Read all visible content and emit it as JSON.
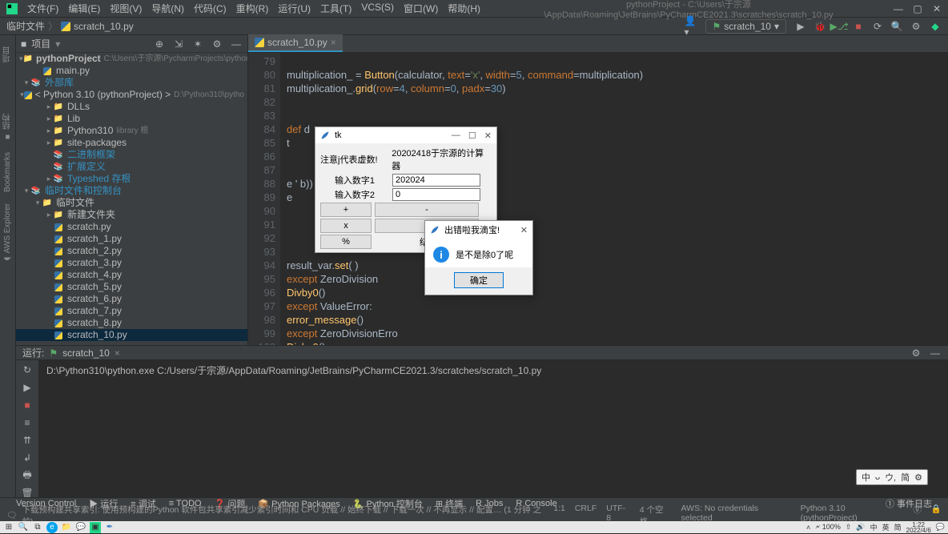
{
  "window": {
    "title_path": "pythonProject - C:\\Users\\于宗源\\AppData\\Roaming\\JetBrains\\PyCharmCE2021.3\\scratches\\scratch_10.py"
  },
  "menus": [
    "文件(F)",
    "编辑(E)",
    "视图(V)",
    "导航(N)",
    "代码(C)",
    "重构(R)",
    "运行(U)",
    "工具(T)",
    "VCS(S)",
    "窗口(W)",
    "帮助(H)"
  ],
  "breadcrumb": {
    "a": "临时文件",
    "b": "scratch_10.py"
  },
  "run_config": {
    "name": "scratch_10"
  },
  "project_panel": {
    "title": "项目"
  },
  "tree": [
    {
      "depth": 0,
      "arrow": "▾",
      "icon": "folder",
      "name": "pythonProject",
      "hint": "C:\\Users\\于宗源\\PycharmProjects\\python",
      "bold": true
    },
    {
      "depth": 1,
      "arrow": "",
      "icon": "py",
      "name": "main.py"
    },
    {
      "depth": 0,
      "arrow": "▾",
      "icon": "lib",
      "name": "外部库",
      "class": "lib"
    },
    {
      "depth": 1,
      "arrow": "▾",
      "icon": "py",
      "name": "< Python 3.10 (pythonProject) >",
      "hint": "D:\\Python310\\pytho"
    },
    {
      "depth": 2,
      "arrow": "▸",
      "icon": "folder",
      "name": "DLLs"
    },
    {
      "depth": 2,
      "arrow": "▸",
      "icon": "folder",
      "name": "Lib"
    },
    {
      "depth": 2,
      "arrow": "▸",
      "icon": "folder",
      "name": "Python310",
      "hint": "library 根"
    },
    {
      "depth": 2,
      "arrow": "▸",
      "icon": "folder",
      "name": "site-packages"
    },
    {
      "depth": 2,
      "arrow": "",
      "icon": "lib",
      "name": "二进制框架",
      "class": "lib"
    },
    {
      "depth": 2,
      "arrow": "",
      "icon": "lib",
      "name": "扩展定义",
      "class": "lib"
    },
    {
      "depth": 2,
      "arrow": "▸",
      "icon": "lib",
      "name": "Typeshed 存根",
      "class": "lib"
    },
    {
      "depth": 0,
      "arrow": "▾",
      "icon": "lib",
      "name": "临时文件和控制台",
      "class": "lib"
    },
    {
      "depth": 1,
      "arrow": "▾",
      "icon": "folder",
      "name": "临时文件"
    },
    {
      "depth": 2,
      "arrow": "▸",
      "icon": "folder",
      "name": "新建文件夹"
    },
    {
      "depth": 2,
      "arrow": "",
      "icon": "py",
      "name": "scratch.py"
    },
    {
      "depth": 2,
      "arrow": "",
      "icon": "py",
      "name": "scratch_1.py"
    },
    {
      "depth": 2,
      "arrow": "",
      "icon": "py",
      "name": "scratch_2.py"
    },
    {
      "depth": 2,
      "arrow": "",
      "icon": "py",
      "name": "scratch_3.py"
    },
    {
      "depth": 2,
      "arrow": "",
      "icon": "py",
      "name": "scratch_4.py"
    },
    {
      "depth": 2,
      "arrow": "",
      "icon": "py",
      "name": "scratch_5.py"
    },
    {
      "depth": 2,
      "arrow": "",
      "icon": "py",
      "name": "scratch_6.py"
    },
    {
      "depth": 2,
      "arrow": "",
      "icon": "py",
      "name": "scratch_7.py"
    },
    {
      "depth": 2,
      "arrow": "",
      "icon": "py",
      "name": "scratch_8.py"
    },
    {
      "depth": 2,
      "arrow": "",
      "icon": "py",
      "name": "scratch_10.py",
      "sel": true
    }
  ],
  "editor": {
    "tab": "scratch_10.py",
    "line_start": 79,
    "lines": [
      "",
      "multiplication_ = Button(calculator, text='x', width=5, command=multiplication)",
      "multiplication_.grid(row=4, column=0, padx=30)",
      "",
      "",
      "def d",
      "    t",
      "",
      "",
      "        ",
      "        e                                                                 ' b))",
      "        e",
      "",
      "",
      "",
      "",
      "            result_var.set(                           )",
      "        except ZeroDivision",
      "            Divby0()",
      "        except ValueError:",
      "            error_message()",
      "    except ZeroDivisionErro",
      "        Divby0()"
    ]
  },
  "run": {
    "label": "运行:",
    "config": "scratch_10",
    "output": "D:\\Python310\\python.exe C:/Users/于宗源/AppData/Roaming/JetBrains/PyCharmCE2021.3/scratches/scratch_10.py"
  },
  "bottom_tabs": [
    "Version Control",
    "▶ 运行",
    "≡ 调试",
    "≡ TODO",
    "❓ 问题",
    "📦 Python Packages",
    "🐍 Python 控制台",
    "⊞ 终端",
    "R Jobs",
    "R Console"
  ],
  "bottom_right": "① 事件日志",
  "status": {
    "msg": "下载预构建共享索引: 使用预构建的Python 软件包共享索引减少索引时间和 CPU 负载 // 始终下载 // 下载一次 // 不再显示 // 配置… (1 分钟 之前)",
    "pos": "1:1",
    "crlf": "CRLF",
    "enc": "UTF-8",
    "indent": "4 个空格",
    "aws": "AWS: No credentials selected",
    "sdk": "Python 3.10 (pythonProject)"
  },
  "ime": {
    "items": [
      "中",
      "ᴗ",
      "ウ,",
      "简",
      "⚙"
    ]
  },
  "tk": {
    "title": "tk",
    "note": "注意j代表虚数!",
    "header": "20202418于宗源的计算器",
    "l1": "输入数字1",
    "l2": "输入数字2",
    "v1": "202024",
    "v2": "0",
    "plus": "+",
    "minus": "-",
    "mul": "x",
    "div": "/",
    "mod": "%",
    "res_prefix": "结"
  },
  "msgbox": {
    "title": "出错啦我滴宝!",
    "text": "是不是除0了呢",
    "ok": "确定"
  },
  "tray": {
    "battery": "100%",
    "time": "1:22",
    "date": "2022/4/6",
    "ime1": "中",
    "ime2": "英",
    "ime3": "简"
  }
}
